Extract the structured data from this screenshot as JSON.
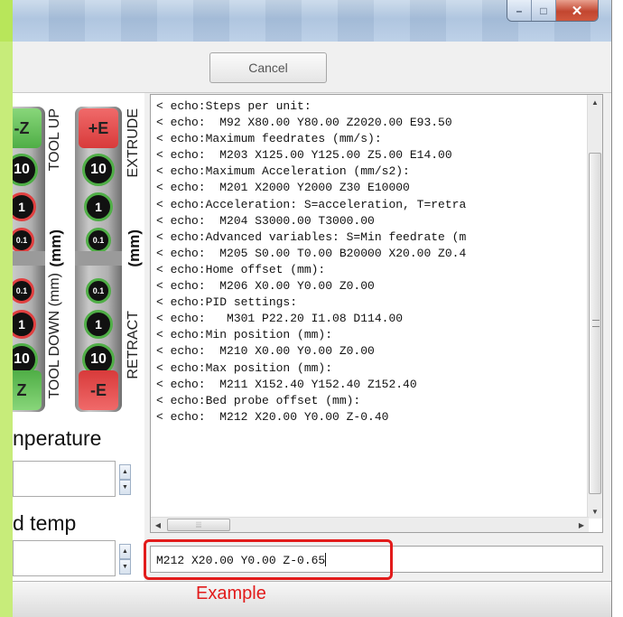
{
  "window": {
    "titlebar_buttons": [
      {
        "name": "minimize-icon",
        "glyph": "–"
      },
      {
        "name": "maximize-icon",
        "glyph": "□"
      },
      {
        "name": "close-icon",
        "glyph": "✕"
      }
    ]
  },
  "toolbar": {
    "cancel_label": "Cancel"
  },
  "jog": {
    "left_column": {
      "top_label": "-Z",
      "bottom_label": "Z",
      "steps_up": [
        "10",
        "1",
        "0.1"
      ],
      "steps_down": [
        "0.1",
        "1",
        "10"
      ]
    },
    "right_column": {
      "top_label": "+E",
      "bottom_label": "-E",
      "steps_up": [
        "10",
        "1",
        "0.1"
      ],
      "steps_down": [
        "0.1",
        "1",
        "10"
      ]
    },
    "labels": {
      "tool_up": "TOOL UP",
      "tool_down_mm": "TOOL DOWN (mm)",
      "extrude": "EXTRUDE",
      "retract": "RETRACT",
      "mm_left": "(mm)",
      "mm_right": "(mm)"
    }
  },
  "temperature": {
    "extruder_label": "nperature",
    "bed_label": "d temp",
    "extruder_value": "",
    "bed_value": ""
  },
  "console": {
    "lines": [
      "< echo:Steps per unit:",
      "< echo:  M92 X80.00 Y80.00 Z2020.00 E93.50",
      "< echo:Maximum feedrates (mm/s):",
      "< echo:  M203 X125.00 Y125.00 Z5.00 E14.00",
      "< echo:Maximum Acceleration (mm/s2):",
      "< echo:  M201 X2000 Y2000 Z30 E10000",
      "< echo:Acceleration: S=acceleration, T=retra",
      "< echo:  M204 S3000.00 T3000.00",
      "< echo:Advanced variables: S=Min feedrate (m",
      "< echo:  M205 S0.00 T0.00 B20000 X20.00 Z0.4",
      "< echo:Home offset (mm):",
      "< echo:  M206 X0.00 Y0.00 Z0.00",
      "< echo:PID settings:",
      "< echo:   M301 P22.20 I1.08 D114.00",
      "< echo:Min position (mm):",
      "< echo:  M210 X0.00 Y0.00 Z0.00",
      "< echo:Max position (mm):",
      "< echo:  M211 X152.40 Y152.40 Z152.40",
      "< echo:Bed probe offset (mm):",
      "< echo:  M212 X20.00 Y0.00 Z-0.40"
    ]
  },
  "command": {
    "value": "M212 X20.00 Y0.00 Z-0.65"
  },
  "annotation": {
    "label": "Example",
    "color": "#e21b1b"
  },
  "colors": {
    "accent_green": "#4fae46",
    "accent_red": "#e04040"
  }
}
